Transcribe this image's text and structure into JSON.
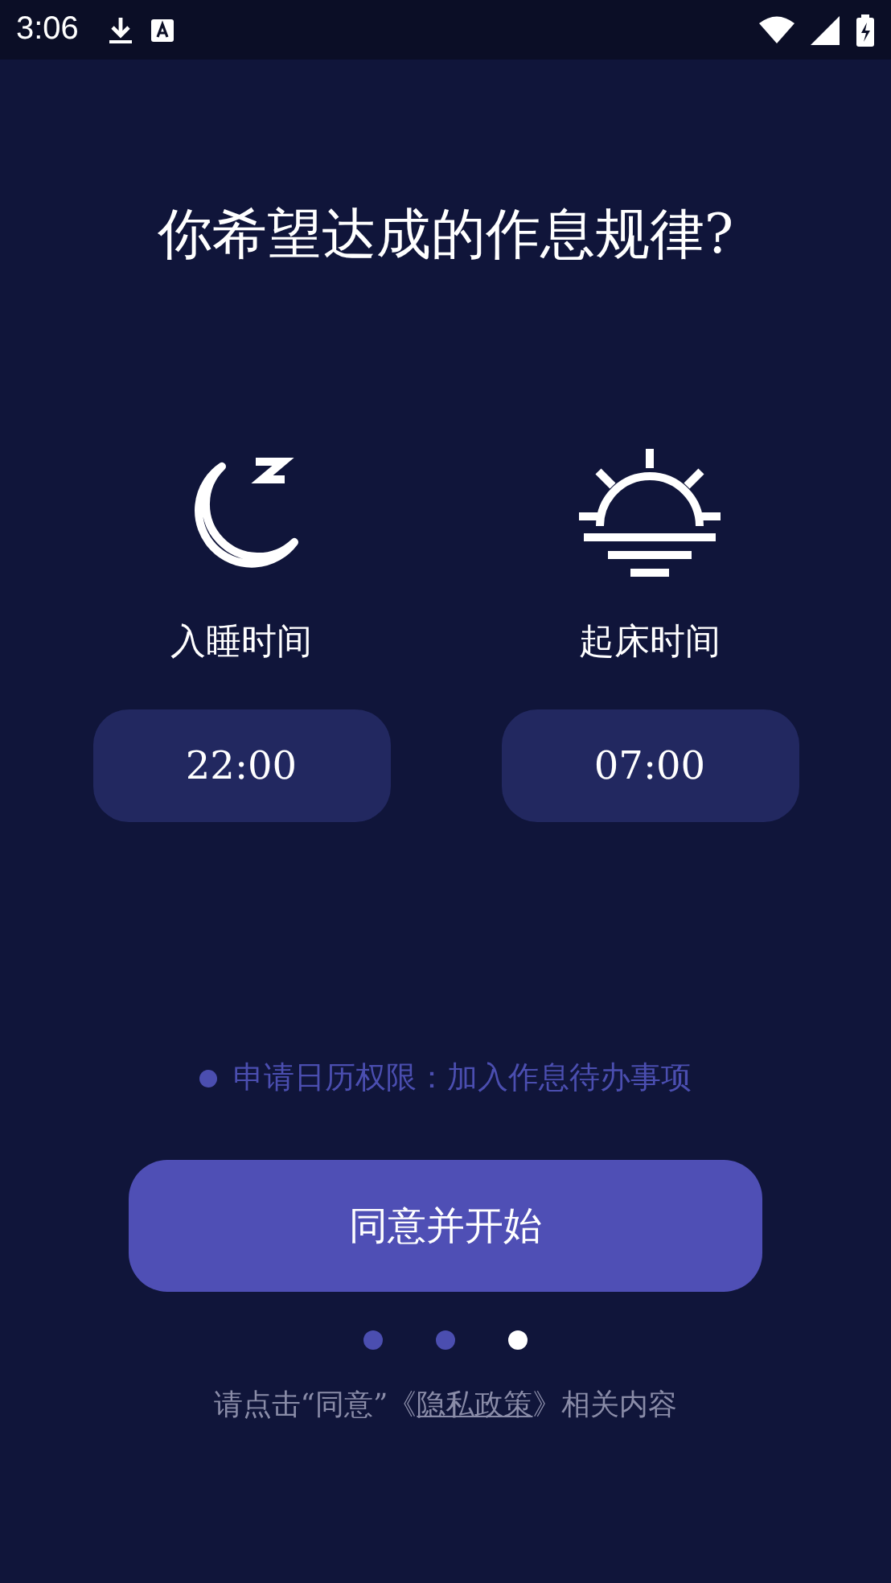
{
  "status_bar": {
    "time": "3:06"
  },
  "title": "你希望达成的作息规律?",
  "schedule": [
    {
      "kind": "sleep",
      "label": "入睡时间",
      "time": "22:00"
    },
    {
      "kind": "wake",
      "label": "起床时间",
      "time": "07:00"
    }
  ],
  "permission_note": "申请日历权限：加入作息待办事项",
  "agree_button": "同意并开始",
  "pages": [
    {
      "selected": false
    },
    {
      "selected": false
    },
    {
      "selected": true
    }
  ],
  "footer": {
    "prefix": "请点击“同意”《",
    "link": "隐私政策",
    "suffix": "》相关内容"
  }
}
